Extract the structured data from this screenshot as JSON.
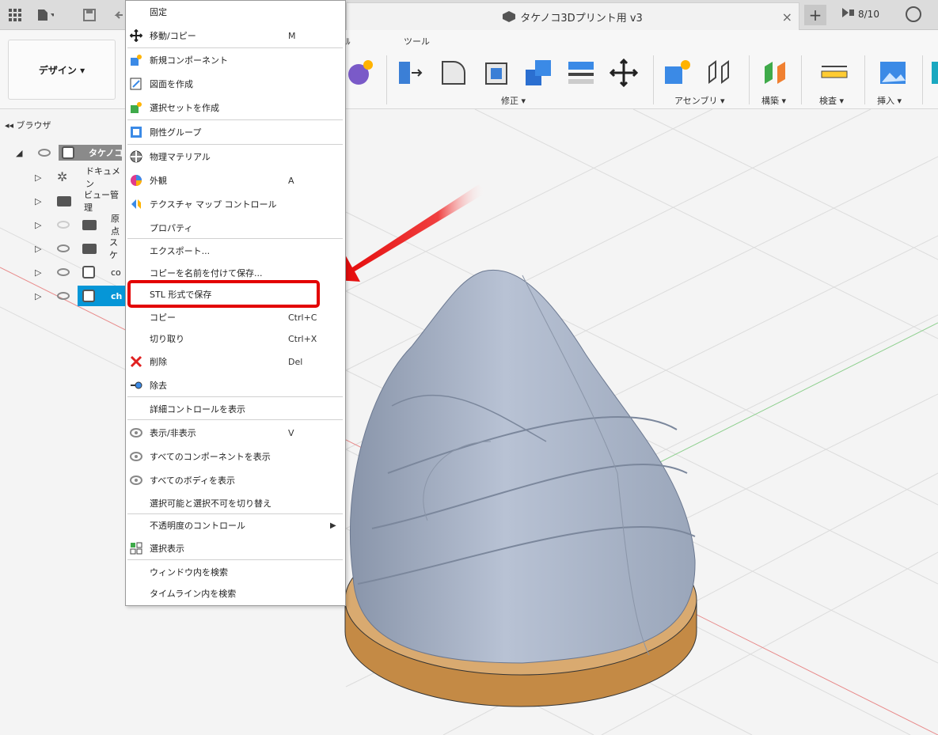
{
  "titlebar": {
    "doc_title": "タケノコ3Dプリント用 v3",
    "job_count": "8/10",
    "close_glyph": "×",
    "add_glyph": "+"
  },
  "toolbar": {
    "workspace": "デザイン ▾",
    "tabs": [
      {
        "label": "ﾙ"
      },
      {
        "label": "ツール"
      }
    ],
    "groups": [
      {
        "label": "修正 ▾"
      },
      {
        "label": "アセンブリ ▾"
      },
      {
        "label": "構築 ▾"
      },
      {
        "label": "検査 ▾"
      },
      {
        "label": "挿入 ▾"
      }
    ]
  },
  "browser": {
    "header": "◂◂ ブラウザ",
    "items": [
      {
        "label": "タケノコ"
      },
      {
        "label": "ドキュメン"
      },
      {
        "label": "ビュー管理"
      },
      {
        "label": "原点"
      },
      {
        "label": "スケ"
      },
      {
        "label": "co"
      },
      {
        "label": "ch"
      }
    ]
  },
  "context_menu": {
    "items": [
      {
        "label": "固定",
        "shortcut": "",
        "icon": "none"
      },
      {
        "label": "移動/コピー",
        "shortcut": "M",
        "icon": "move-arrows-icon"
      },
      {
        "label": "新規コンポーネント",
        "shortcut": "",
        "icon": "new-component-icon"
      },
      {
        "label": "図面を作成",
        "shortcut": "",
        "icon": "drawing-icon"
      },
      {
        "label": "選択セットを作成",
        "shortcut": "",
        "icon": "selection-set-icon"
      },
      {
        "label": "剛性グループ",
        "shortcut": "",
        "icon": "rigid-group-icon"
      },
      {
        "label": "物理マテリアル",
        "shortcut": "",
        "icon": "material-ball-icon"
      },
      {
        "label": "外観",
        "shortcut": "A",
        "icon": "appearance-icon"
      },
      {
        "label": "テクスチャ マップ コントロール",
        "shortcut": "",
        "icon": "texture-map-icon"
      },
      {
        "label": "プロパティ",
        "shortcut": "",
        "icon": "none"
      },
      {
        "label": "エクスポート...",
        "shortcut": "",
        "icon": "none"
      },
      {
        "label": "コピーを名前を付けて保存...",
        "shortcut": "",
        "icon": "none"
      },
      {
        "label": "STL 形式で保存",
        "shortcut": "",
        "icon": "none"
      },
      {
        "label": "コピー",
        "shortcut": "Ctrl+C",
        "icon": "none"
      },
      {
        "label": "切り取り",
        "shortcut": "Ctrl+X",
        "icon": "none"
      },
      {
        "label": "削除",
        "shortcut": "Del",
        "icon": "delete-x-icon"
      },
      {
        "label": "除去",
        "shortcut": "",
        "icon": "remove-icon"
      },
      {
        "label": "詳細コントロールを表示",
        "shortcut": "",
        "icon": "none"
      },
      {
        "label": "表示/非表示",
        "shortcut": "V",
        "icon": "eye-icon"
      },
      {
        "label": "すべてのコンポーネントを表示",
        "shortcut": "",
        "icon": "eye-icon"
      },
      {
        "label": "すべてのボディを表示",
        "shortcut": "",
        "icon": "eye-icon"
      },
      {
        "label": "選択可能と選択不可を切り替え",
        "shortcut": "",
        "icon": "none"
      },
      {
        "label": "不透明度のコントロール",
        "shortcut": "▶",
        "icon": "none"
      },
      {
        "label": "選択表示",
        "shortcut": "",
        "icon": "select-display-icon"
      },
      {
        "label": "ウィンドウ内を検索",
        "shortcut": "",
        "icon": "none"
      },
      {
        "label": "タイムライン内を検索",
        "shortcut": "",
        "icon": "none"
      }
    ]
  },
  "colors": {
    "highlight": "#e30000",
    "selection": "#0696d7",
    "model_body": "#aab5c8",
    "model_base": "#d4a46a"
  }
}
